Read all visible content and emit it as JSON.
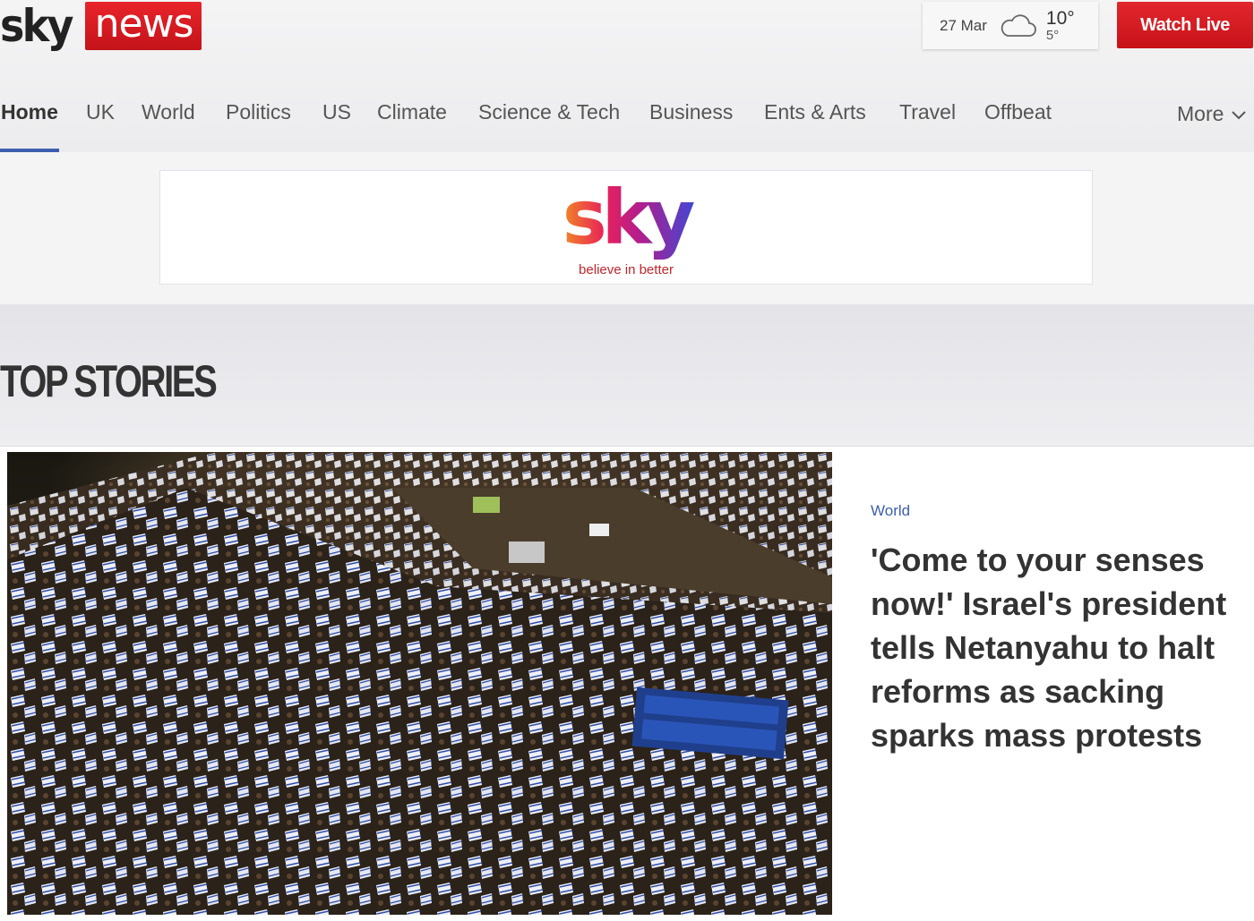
{
  "brand": {
    "sky": "sky",
    "news": "news"
  },
  "weather": {
    "date": "27 Mar",
    "icon": "cloud-icon",
    "high": "10°",
    "low": "5°"
  },
  "watch_live_label": "Watch Live",
  "nav": {
    "items": [
      "Home",
      "UK",
      "World",
      "Politics",
      "US",
      "Climate",
      "Science & Tech",
      "Business",
      "Ents & Arts",
      "Travel",
      "Offbeat"
    ],
    "active": "Home",
    "more_label": "More"
  },
  "ad": {
    "logo": "sky",
    "tagline": "believe in better"
  },
  "section_title": "TOP STORIES",
  "lead_story": {
    "category": "World",
    "headline": "'Come to your senses now!' Israel's president tells Netanyahu to halt reforms as sacking sparks mass protests",
    "image_subject": "night crowd of protesters waving flags on a highway"
  },
  "colors": {
    "brand_red": "#d71920",
    "link_blue": "#3b5fae",
    "background": "#f2f2f4"
  }
}
